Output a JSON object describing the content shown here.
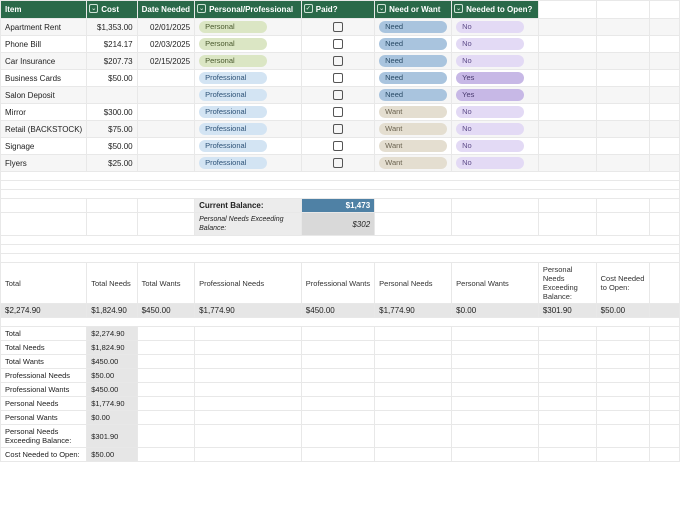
{
  "headers": {
    "item": "Item",
    "cost": "Cost",
    "date": "Date Needed",
    "pp": "Personal/Professional",
    "paid": "Paid?",
    "nw": "Need or Want",
    "open": "Needed to Open?"
  },
  "pill_labels": {
    "Personal": "Personal",
    "Professional": "Professional",
    "Need": "Need",
    "Want": "Want",
    "Yes": "Yes",
    "No": "No"
  },
  "rows": [
    {
      "item": "Apartment Rent",
      "cost": "$1,353.00",
      "date": "02/01/2025",
      "pp": "Personal",
      "paid": false,
      "nw": "Need",
      "open": "No"
    },
    {
      "item": "Phone Bill",
      "cost": "$214.17",
      "date": "02/03/2025",
      "pp": "Personal",
      "paid": false,
      "nw": "Need",
      "open": "No"
    },
    {
      "item": "Car Insurance",
      "cost": "$207.73",
      "date": "02/15/2025",
      "pp": "Personal",
      "paid": false,
      "nw": "Need",
      "open": "No"
    },
    {
      "item": "Business Cards",
      "cost": "$50.00",
      "date": "",
      "pp": "Professional",
      "paid": false,
      "nw": "Need",
      "open": "Yes"
    },
    {
      "item": "Salon Deposit",
      "cost": "",
      "date": "",
      "pp": "Professional",
      "paid": false,
      "nw": "Need",
      "open": "Yes"
    },
    {
      "item": "Mirror",
      "cost": "$300.00",
      "date": "",
      "pp": "Professional",
      "paid": false,
      "nw": "Want",
      "open": "No"
    },
    {
      "item": "Retail (BACKSTOCK)",
      "cost": "$75.00",
      "date": "",
      "pp": "Professional",
      "paid": false,
      "nw": "Want",
      "open": "No"
    },
    {
      "item": "Signage",
      "cost": "$50.00",
      "date": "",
      "pp": "Professional",
      "paid": false,
      "nw": "Want",
      "open": "No"
    },
    {
      "item": "Flyers",
      "cost": "$25.00",
      "date": "",
      "pp": "Professional",
      "paid": false,
      "nw": "Want",
      "open": "No"
    }
  ],
  "balance": {
    "label": "Current Balance:",
    "value": "$1,473",
    "exceed_label": "Personal Needs Exceeding Balance:",
    "exceed_value": "$302"
  },
  "totals_headers": [
    "Total",
    "Total Needs",
    "Total Wants",
    "Professional Needs",
    "Professional Wants",
    "Personal Needs",
    "Personal Wants",
    "Personal Needs Exceeding Balance:",
    "Cost Needed to Open:"
  ],
  "totals_values": [
    "$2,274.90",
    "$1,824.90",
    "$450.00",
    "$1,774.90",
    "$450.00",
    "$1,774.90",
    "$0.00",
    "$301.90",
    "$50.00"
  ],
  "side": [
    {
      "label": "Total",
      "value": "$2,274.90"
    },
    {
      "label": "Total Needs",
      "value": "$1,824.90"
    },
    {
      "label": "Total Wants",
      "value": "$450.00"
    },
    {
      "label": "Professional Needs",
      "value": "$50.00"
    },
    {
      "label": "Professional Wants",
      "value": "$450.00"
    },
    {
      "label": "Personal Needs",
      "value": "$1,774.90"
    },
    {
      "label": "Personal Wants",
      "value": "$0.00"
    },
    {
      "label": "Personal Needs Exceeding Balance:",
      "value": "$301.90"
    },
    {
      "label": "Cost Needed to Open:",
      "value": "$50.00"
    }
  ]
}
